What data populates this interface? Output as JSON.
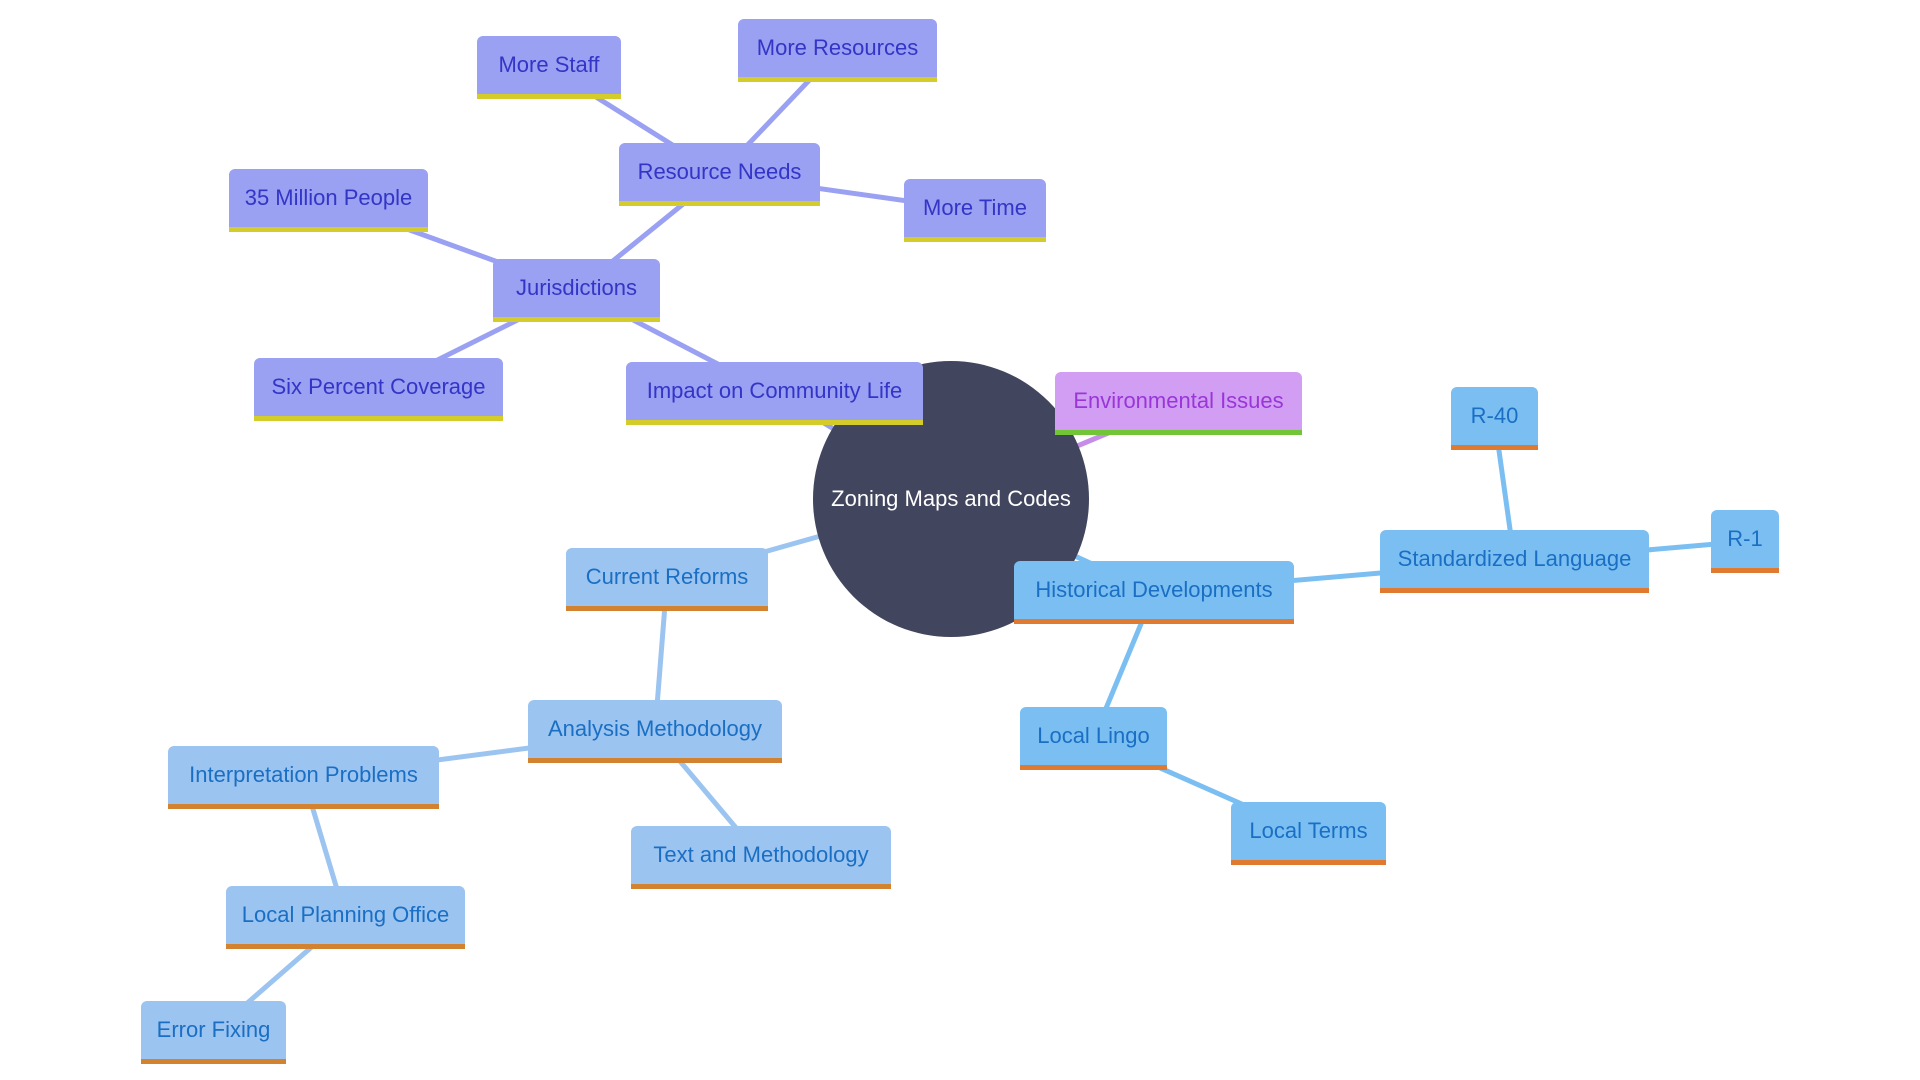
{
  "title": "Zoning Maps and Codes",
  "colors": {
    "center": "#41455d",
    "purple_group": "#9aa0f2",
    "violet_group": "#d19ef3",
    "blue_group": "#7bbff2",
    "light_blue_group": "#9cc4f0"
  },
  "center": {
    "label": "Zoning Maps and Codes"
  },
  "nodes": {
    "impact": {
      "label": "Impact on Community Life"
    },
    "jurisdictions": {
      "label": "Jurisdictions"
    },
    "resource_needs": {
      "label": "Resource Needs"
    },
    "more_staff": {
      "label": "More Staff"
    },
    "more_resources": {
      "label": "More Resources"
    },
    "more_time": {
      "label": "More Time"
    },
    "million_people": {
      "label": "35 Million People"
    },
    "six_percent": {
      "label": "Six Percent Coverage"
    },
    "environmental": {
      "label": "Environmental Issues"
    },
    "historical": {
      "label": "Historical Developments"
    },
    "standardized": {
      "label": "Standardized Language"
    },
    "r40": {
      "label": "R-40"
    },
    "r1": {
      "label": "R-1"
    },
    "local_lingo": {
      "label": "Local Lingo"
    },
    "local_terms": {
      "label": "Local Terms"
    },
    "current_reforms": {
      "label": "Current Reforms"
    },
    "analysis": {
      "label": "Analysis Methodology"
    },
    "interpretation": {
      "label": "Interpretation Problems"
    },
    "text_method": {
      "label": "Text and Methodology"
    },
    "planning_office": {
      "label": "Local Planning Office"
    },
    "error_fixing": {
      "label": "Error Fixing"
    }
  },
  "edges": [
    [
      "center",
      "impact"
    ],
    [
      "impact",
      "jurisdictions"
    ],
    [
      "jurisdictions",
      "resource_needs"
    ],
    [
      "resource_needs",
      "more_staff"
    ],
    [
      "resource_needs",
      "more_resources"
    ],
    [
      "resource_needs",
      "more_time"
    ],
    [
      "jurisdictions",
      "million_people"
    ],
    [
      "jurisdictions",
      "six_percent"
    ],
    [
      "center",
      "environmental"
    ],
    [
      "center",
      "historical"
    ],
    [
      "historical",
      "standardized"
    ],
    [
      "standardized",
      "r40"
    ],
    [
      "standardized",
      "r1"
    ],
    [
      "historical",
      "local_lingo"
    ],
    [
      "local_lingo",
      "local_terms"
    ],
    [
      "center",
      "current_reforms"
    ],
    [
      "current_reforms",
      "analysis"
    ],
    [
      "analysis",
      "interpretation"
    ],
    [
      "analysis",
      "text_method"
    ],
    [
      "interpretation",
      "planning_office"
    ],
    [
      "planning_office",
      "error_fixing"
    ]
  ]
}
